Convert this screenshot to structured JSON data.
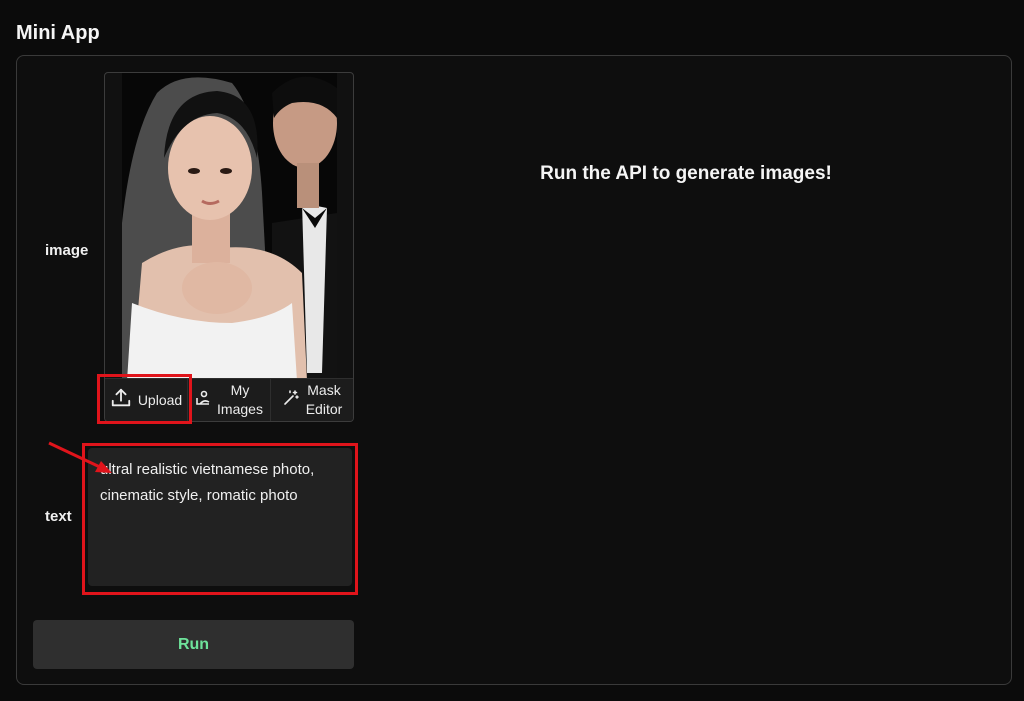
{
  "app": {
    "title": "Mini App"
  },
  "form": {
    "image_label": "image",
    "text_label": "text",
    "toolbar": {
      "upload_label": "Upload",
      "my_images_label": "My\nImages",
      "mask_editor_label": "Mask\nEditor"
    },
    "prompt_value": "ultral realistic vietnamese photo, cinematic style, romatic photo",
    "run_label": "Run"
  },
  "output": {
    "message": "Run the API to generate images!"
  },
  "colors": {
    "highlight": "#e0141b",
    "run_text": "#6ee39b",
    "background": "#0b0b0b"
  }
}
